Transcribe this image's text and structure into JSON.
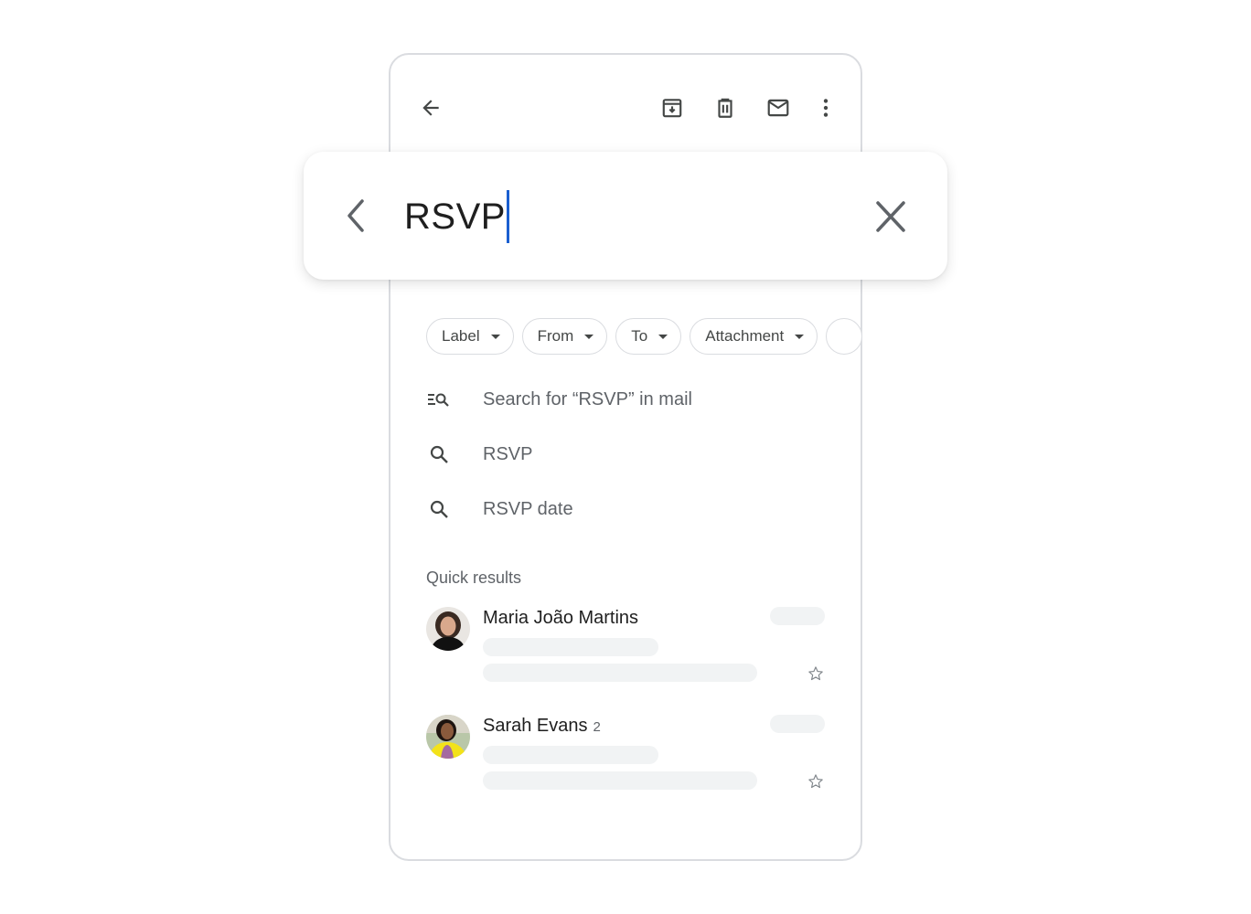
{
  "toolbar": {
    "back_icon": "arrow-back-icon",
    "actions": [
      {
        "name": "archive",
        "icon": "archive-icon"
      },
      {
        "name": "delete",
        "icon": "trash-icon"
      },
      {
        "name": "mark-unread",
        "icon": "mail-icon"
      },
      {
        "name": "more",
        "icon": "more-vertical-icon"
      }
    ]
  },
  "search": {
    "value": "RSVP",
    "back_icon": "chevron-left-icon",
    "clear_icon": "close-icon",
    "caret_color": "#1a5fd0"
  },
  "filters": [
    {
      "label": "Label"
    },
    {
      "label": "From"
    },
    {
      "label": "To"
    },
    {
      "label": "Attachment"
    },
    {
      "label": ""
    }
  ],
  "suggestions": [
    {
      "icon": "search-in-mail-icon",
      "text": "Search for “RSVP” in mail"
    },
    {
      "icon": "search-icon",
      "text": "RSVP"
    },
    {
      "icon": "search-icon",
      "text": "RSVP date"
    }
  ],
  "quick_results": {
    "heading": "Quick results",
    "items": [
      {
        "name": "Maria João Martins",
        "count": "",
        "starred": false
      },
      {
        "name": "Sarah Evans",
        "count": "2",
        "starred": false
      }
    ]
  },
  "colors": {
    "border": "#dadce0",
    "placeholder": "#f1f3f4",
    "icon": "#444746",
    "secondary_text": "#5f6368"
  }
}
